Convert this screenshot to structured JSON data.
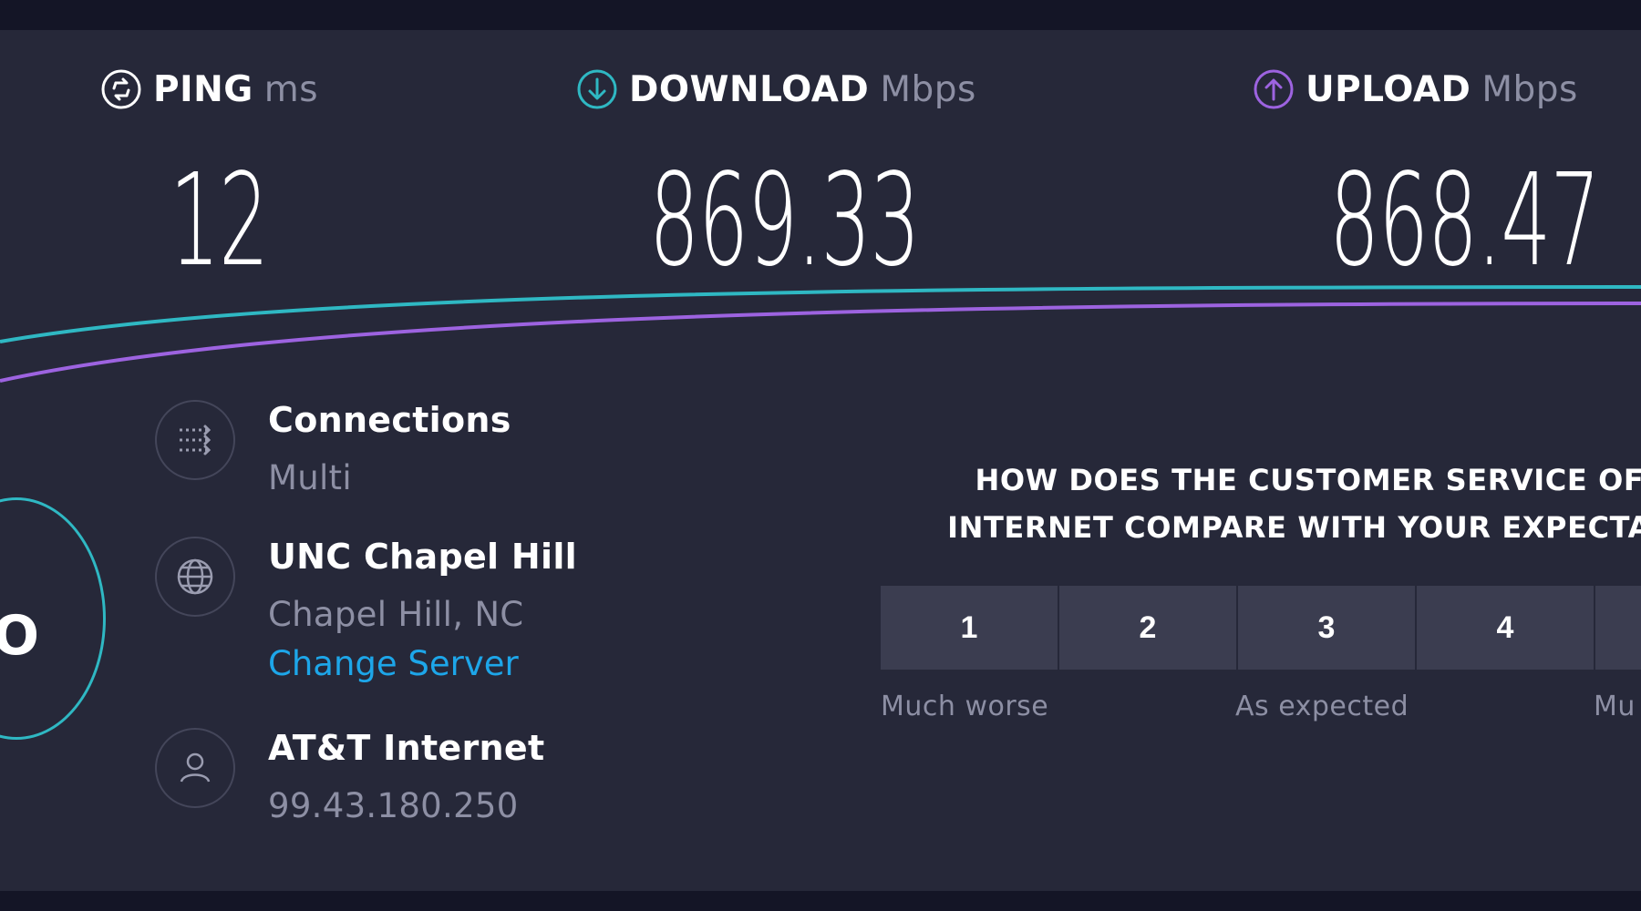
{
  "metrics": {
    "ping": {
      "label": "PING",
      "unit": "ms",
      "value": "12"
    },
    "download": {
      "label": "DOWNLOAD",
      "unit": "Mbps",
      "value": "869.33"
    },
    "upload": {
      "label": "UPLOAD",
      "unit": "Mbps",
      "value": "868.47"
    }
  },
  "gauge": {
    "visible_text": "O"
  },
  "connections": {
    "title": "Connections",
    "value": "Multi"
  },
  "server": {
    "title": "UNC Chapel Hill",
    "location": "Chapel Hill, NC",
    "change_link": "Change Server"
  },
  "provider": {
    "title": "AT&T Internet",
    "ip": "99.43.180.250"
  },
  "survey": {
    "question_line1": "HOW DOES THE CUSTOMER SERVICE OF A",
    "question_line2": "INTERNET COMPARE WITH YOUR EXPECTAT",
    "ratings": [
      "1",
      "2",
      "3",
      "4"
    ],
    "labels": {
      "low": "Much worse",
      "mid": "As expected",
      "high": "Mu"
    }
  },
  "colors": {
    "background": "#262839",
    "download_accent": "#2fb8c3",
    "upload_accent": "#9d63e0",
    "link": "#1da6e9"
  }
}
